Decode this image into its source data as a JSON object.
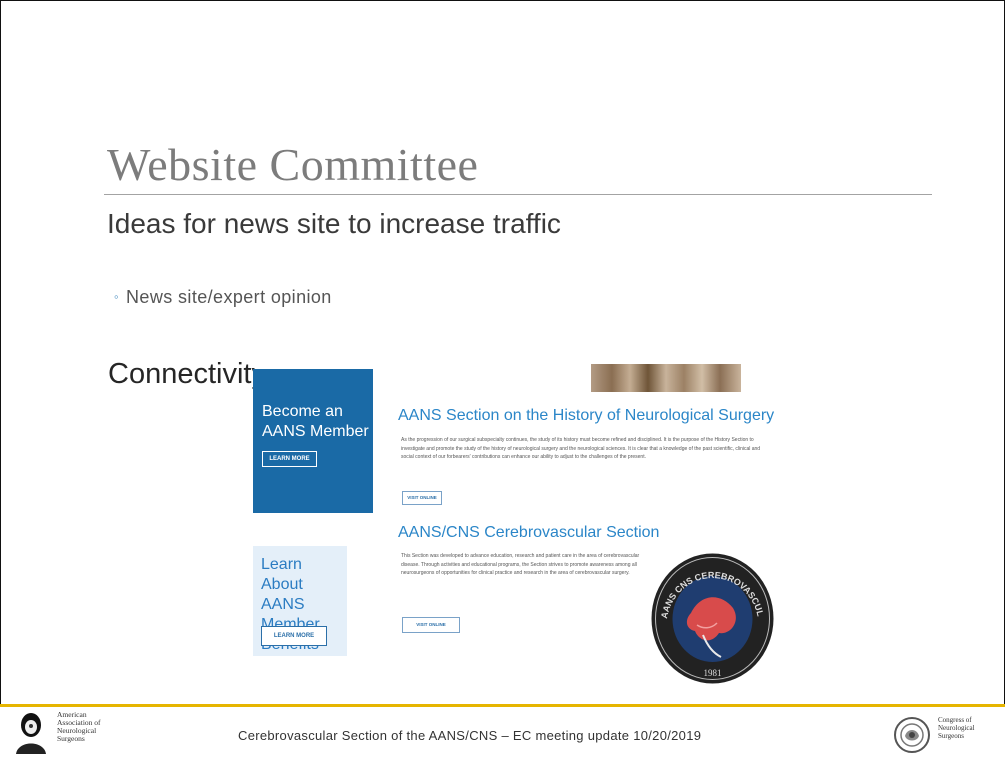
{
  "slide": {
    "title": "Website Committee",
    "subtitle": "Ideas for news site to increase traffic",
    "bullet": "News site/expert opinion",
    "connect_partial": "Connectivity"
  },
  "web_screenshot": {
    "become_member": "Become an AANS Member",
    "learn_more_1": "LEARN MORE",
    "learn_about": "Learn About AANS Member Benefits",
    "learn_more_2": "LEARN MORE",
    "history_heading": "AANS Section on the History of Neurological Surgery",
    "history_body": "As the progression of our surgical subspecialty continues, the study of its history must become refined and disciplined. It is the purpose of the History Section to investigate and promote the study of the history of neurological surgery and the neurological sciences. It is clear that a knowledge of the past scientific, clinical and social context of our forbearers' contributions can enhance our ability to adjust to the challenges of the present.",
    "visit_online_1": "VISIT ONLINE",
    "cv_heading": "AANS/CNS Cerebrovascular Section",
    "cv_body": "This Section was developed to advance education, research and patient care in the area of cerebrovascular disease. Through activities and educational programs, the Section strives to promote awareness among all neurosurgeons of opportunities for clinical practice and research in the area of cerebrovascular surgery.",
    "visit_online_2": "VISIT ONLINE",
    "seal_text": "AANS CNS CEREBROVASCULAR SECTION",
    "seal_year": "1981"
  },
  "footer": {
    "aans_name": "American Association of Neurological Surgeons",
    "text": "Cerebrovascular Section of the AANS/CNS – EC meeting update 10/20/2019",
    "cns_name": "Congress of Neurological Surgeons"
  },
  "colors": {
    "accent_blue": "#1a6aa6",
    "link_blue": "#2b86c8",
    "footer_gold": "#e6b500",
    "title_gray": "#7c7c7c"
  }
}
